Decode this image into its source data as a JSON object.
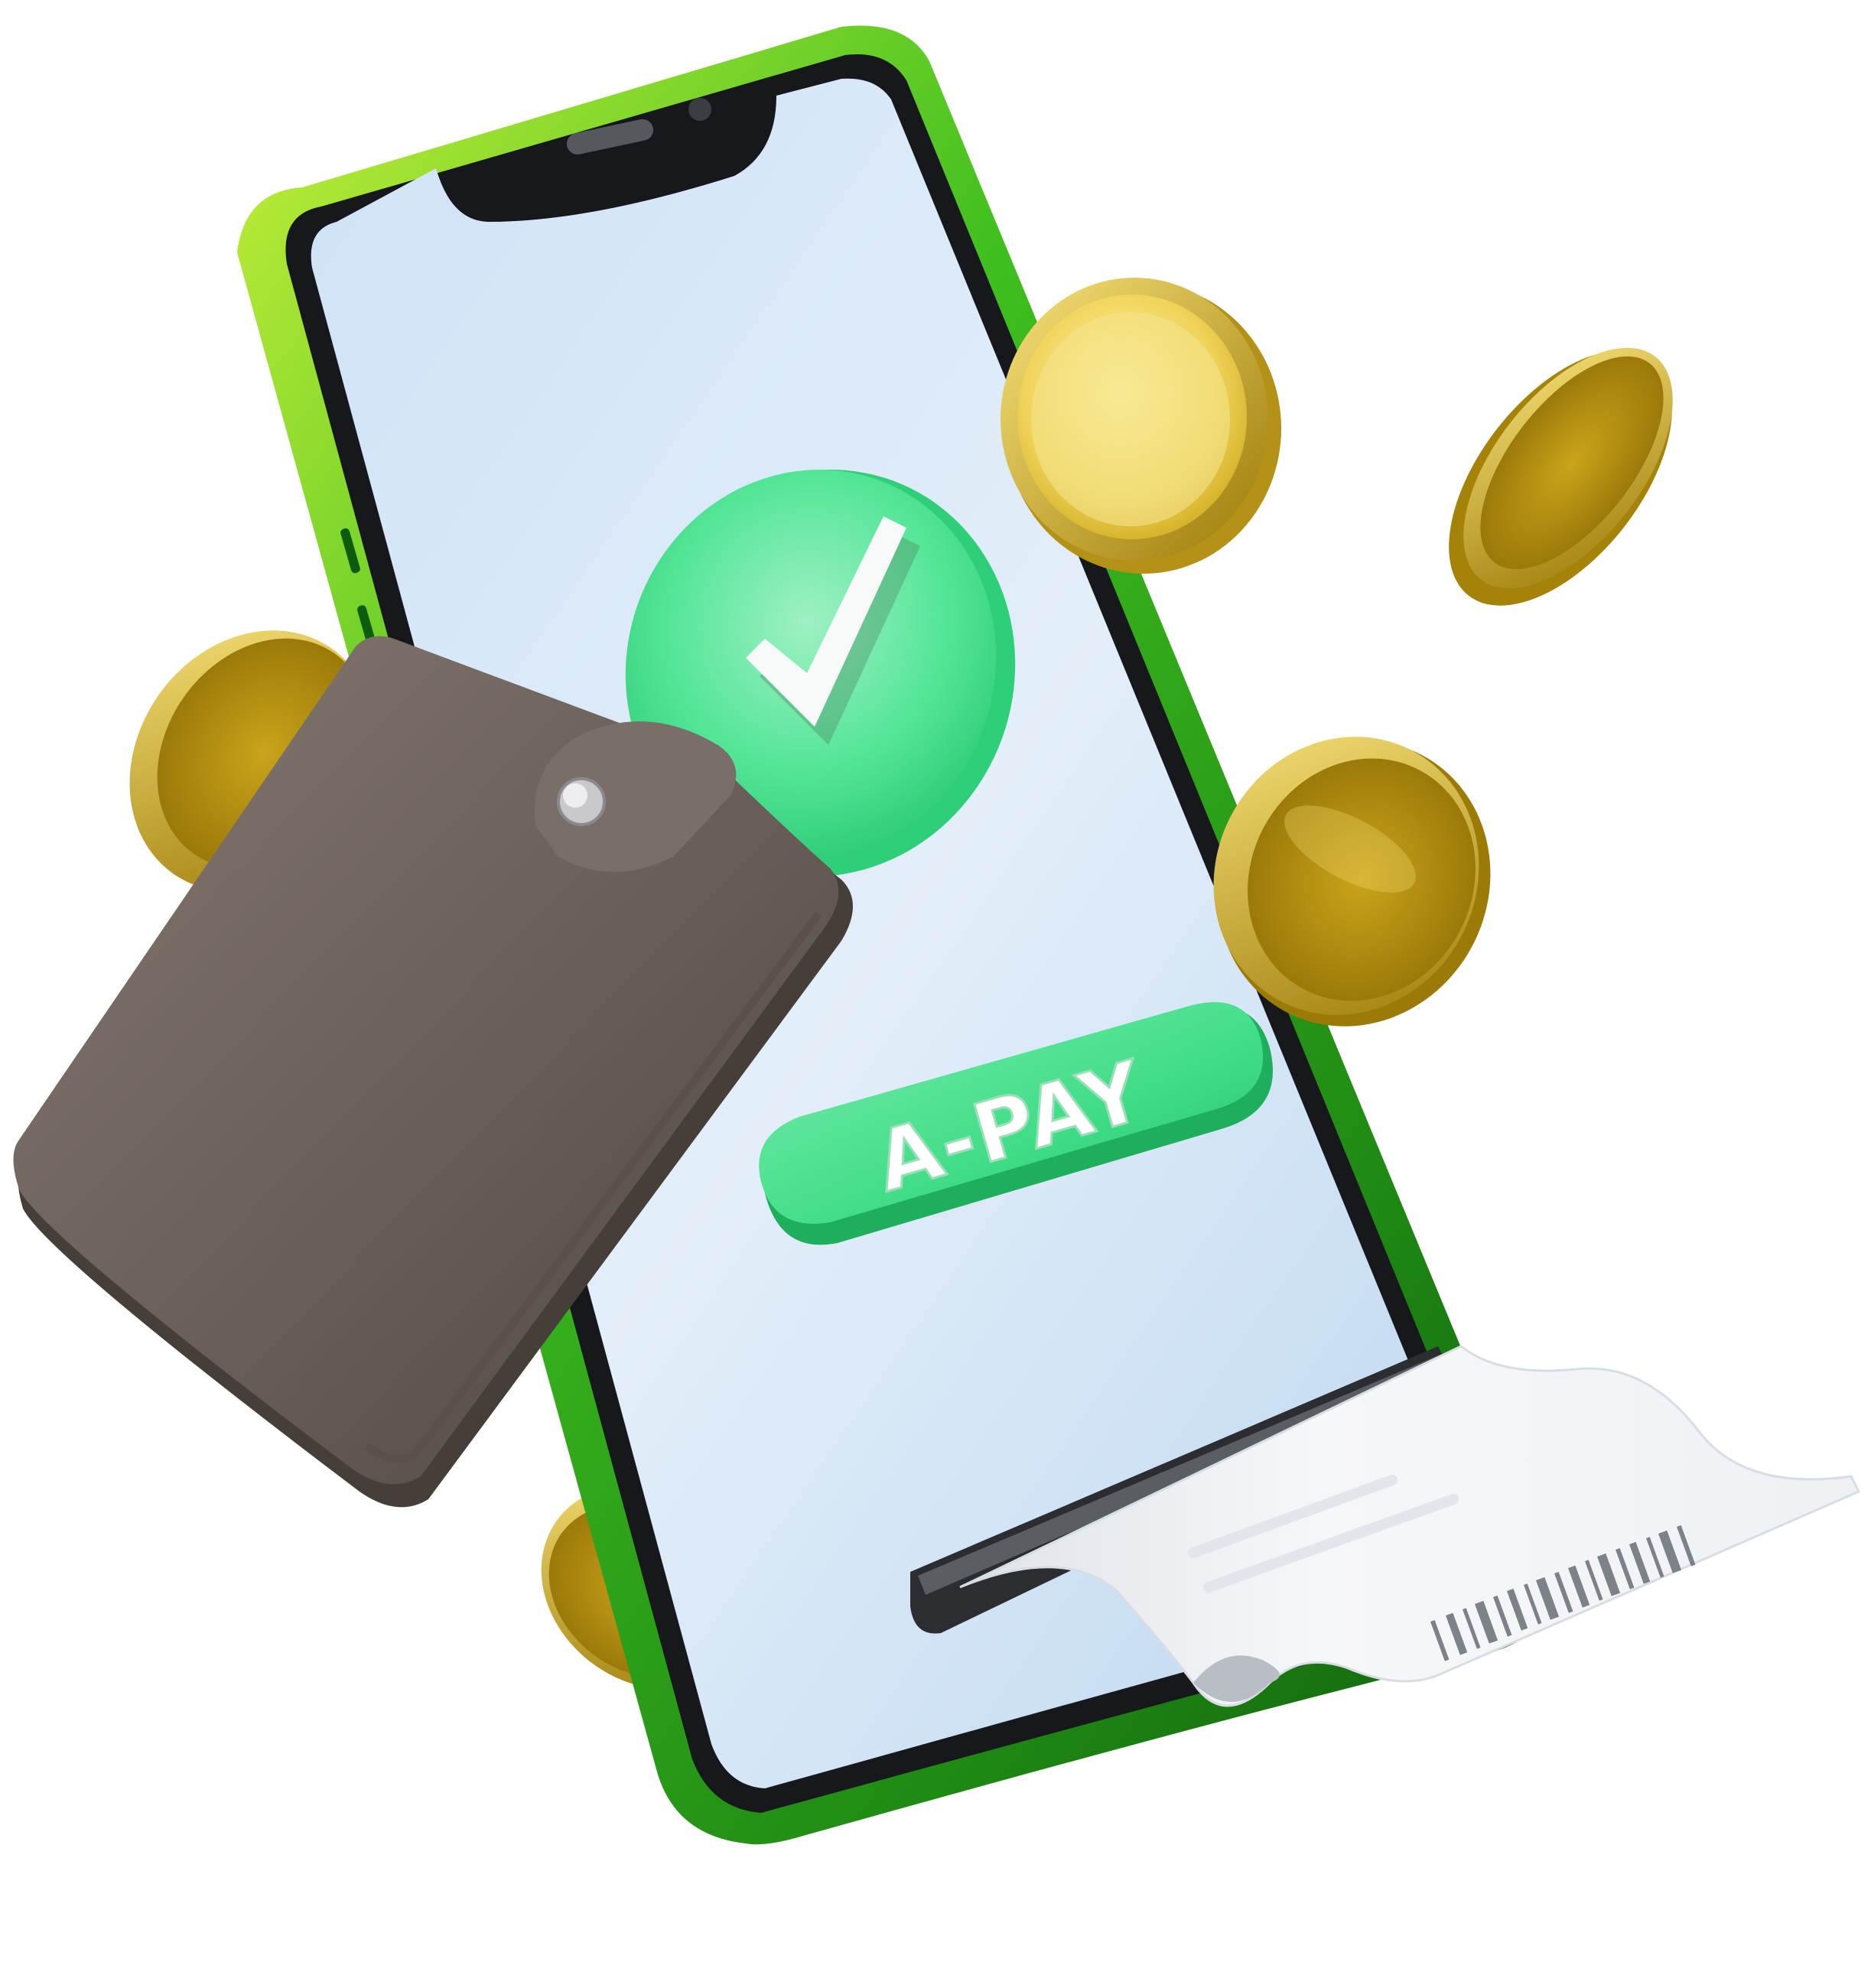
{
  "illustration": {
    "pay_button": {
      "label": "A-PAY"
    },
    "icons": {
      "check": "check-icon",
      "wallet": "wallet-icon",
      "coin": "coin-icon",
      "receipt": "receipt-icon",
      "phone": "smartphone-icon"
    },
    "colors": {
      "phone_frame": "#3fbf1f",
      "phone_frame_dark": "#167a10",
      "screen": "#dcebfb",
      "accent_green": "#3ee08a",
      "coin_gold": "#d9b624",
      "wallet_brown": "#6d625c",
      "receipt": "#f2f4f6"
    }
  }
}
